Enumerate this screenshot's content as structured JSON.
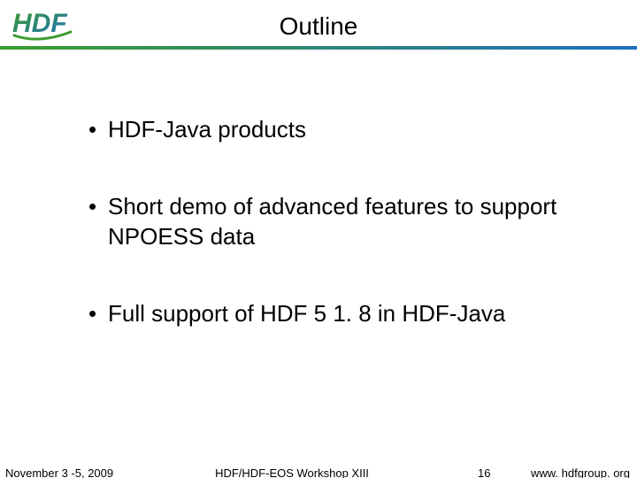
{
  "title": "Outline",
  "logo_text": "HDF",
  "bullets": [
    "HDF-Java products",
    "Short demo of advanced features to support NPOESS data",
    "Full support of HDF 5 1. 8 in HDF-Java"
  ],
  "footer": {
    "date": "November 3 -5, 2009",
    "center": "HDF/HDF-EOS Workshop XIII",
    "page": "16",
    "url": "www. hdfgroup. org"
  },
  "colors": {
    "grad_start": "#3b9d2d",
    "grad_end": "#1e6fbf"
  }
}
